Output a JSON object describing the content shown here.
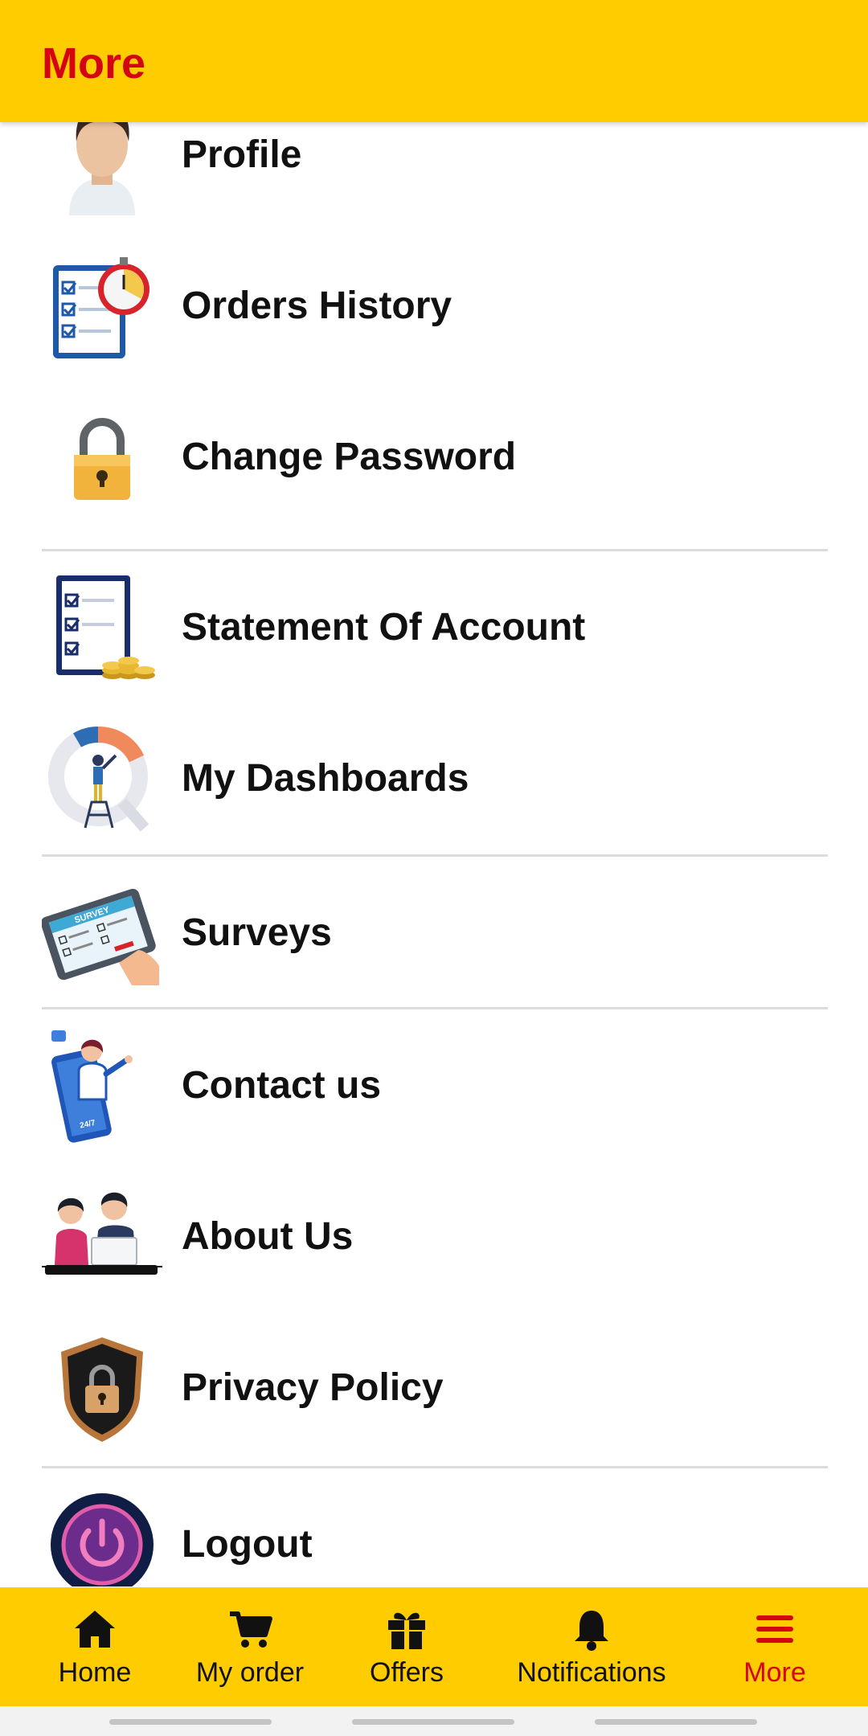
{
  "header": {
    "title": "More"
  },
  "menu": {
    "items": [
      {
        "label": "Profile",
        "icon": "profile-avatar-icon"
      },
      {
        "label": "Orders History",
        "icon": "clipboard-stopwatch-icon"
      },
      {
        "label": "Change Password",
        "icon": "padlock-icon"
      },
      {
        "label": "Statement Of Account",
        "icon": "checklist-coins-icon"
      },
      {
        "label": "My Dashboards",
        "icon": "dashboard-analytics-icon"
      },
      {
        "label": "Surveys",
        "icon": "survey-tablet-icon"
      },
      {
        "label": "Contact us",
        "icon": "support-agent-phone-icon"
      },
      {
        "label": "About Us",
        "icon": "team-people-icon"
      },
      {
        "label": "Privacy Policy",
        "icon": "shield-lock-icon"
      },
      {
        "label": "Logout",
        "icon": "power-icon"
      }
    ],
    "survey_icon_text": "SURVEY",
    "contact_icon_text": "24/7"
  },
  "bottom_nav": {
    "items": [
      {
        "label": "Home",
        "icon": "home-icon"
      },
      {
        "label": "My order",
        "icon": "cart-icon"
      },
      {
        "label": "Offers",
        "icon": "gift-icon"
      },
      {
        "label": "Notifications",
        "icon": "bell-icon"
      },
      {
        "label": "More",
        "icon": "menu-icon"
      }
    ],
    "active": "More"
  },
  "colors": {
    "brand_yellow": "#FFCC00",
    "brand_red": "#D40511",
    "text": "#111111",
    "divider": "#DCDCDC"
  }
}
